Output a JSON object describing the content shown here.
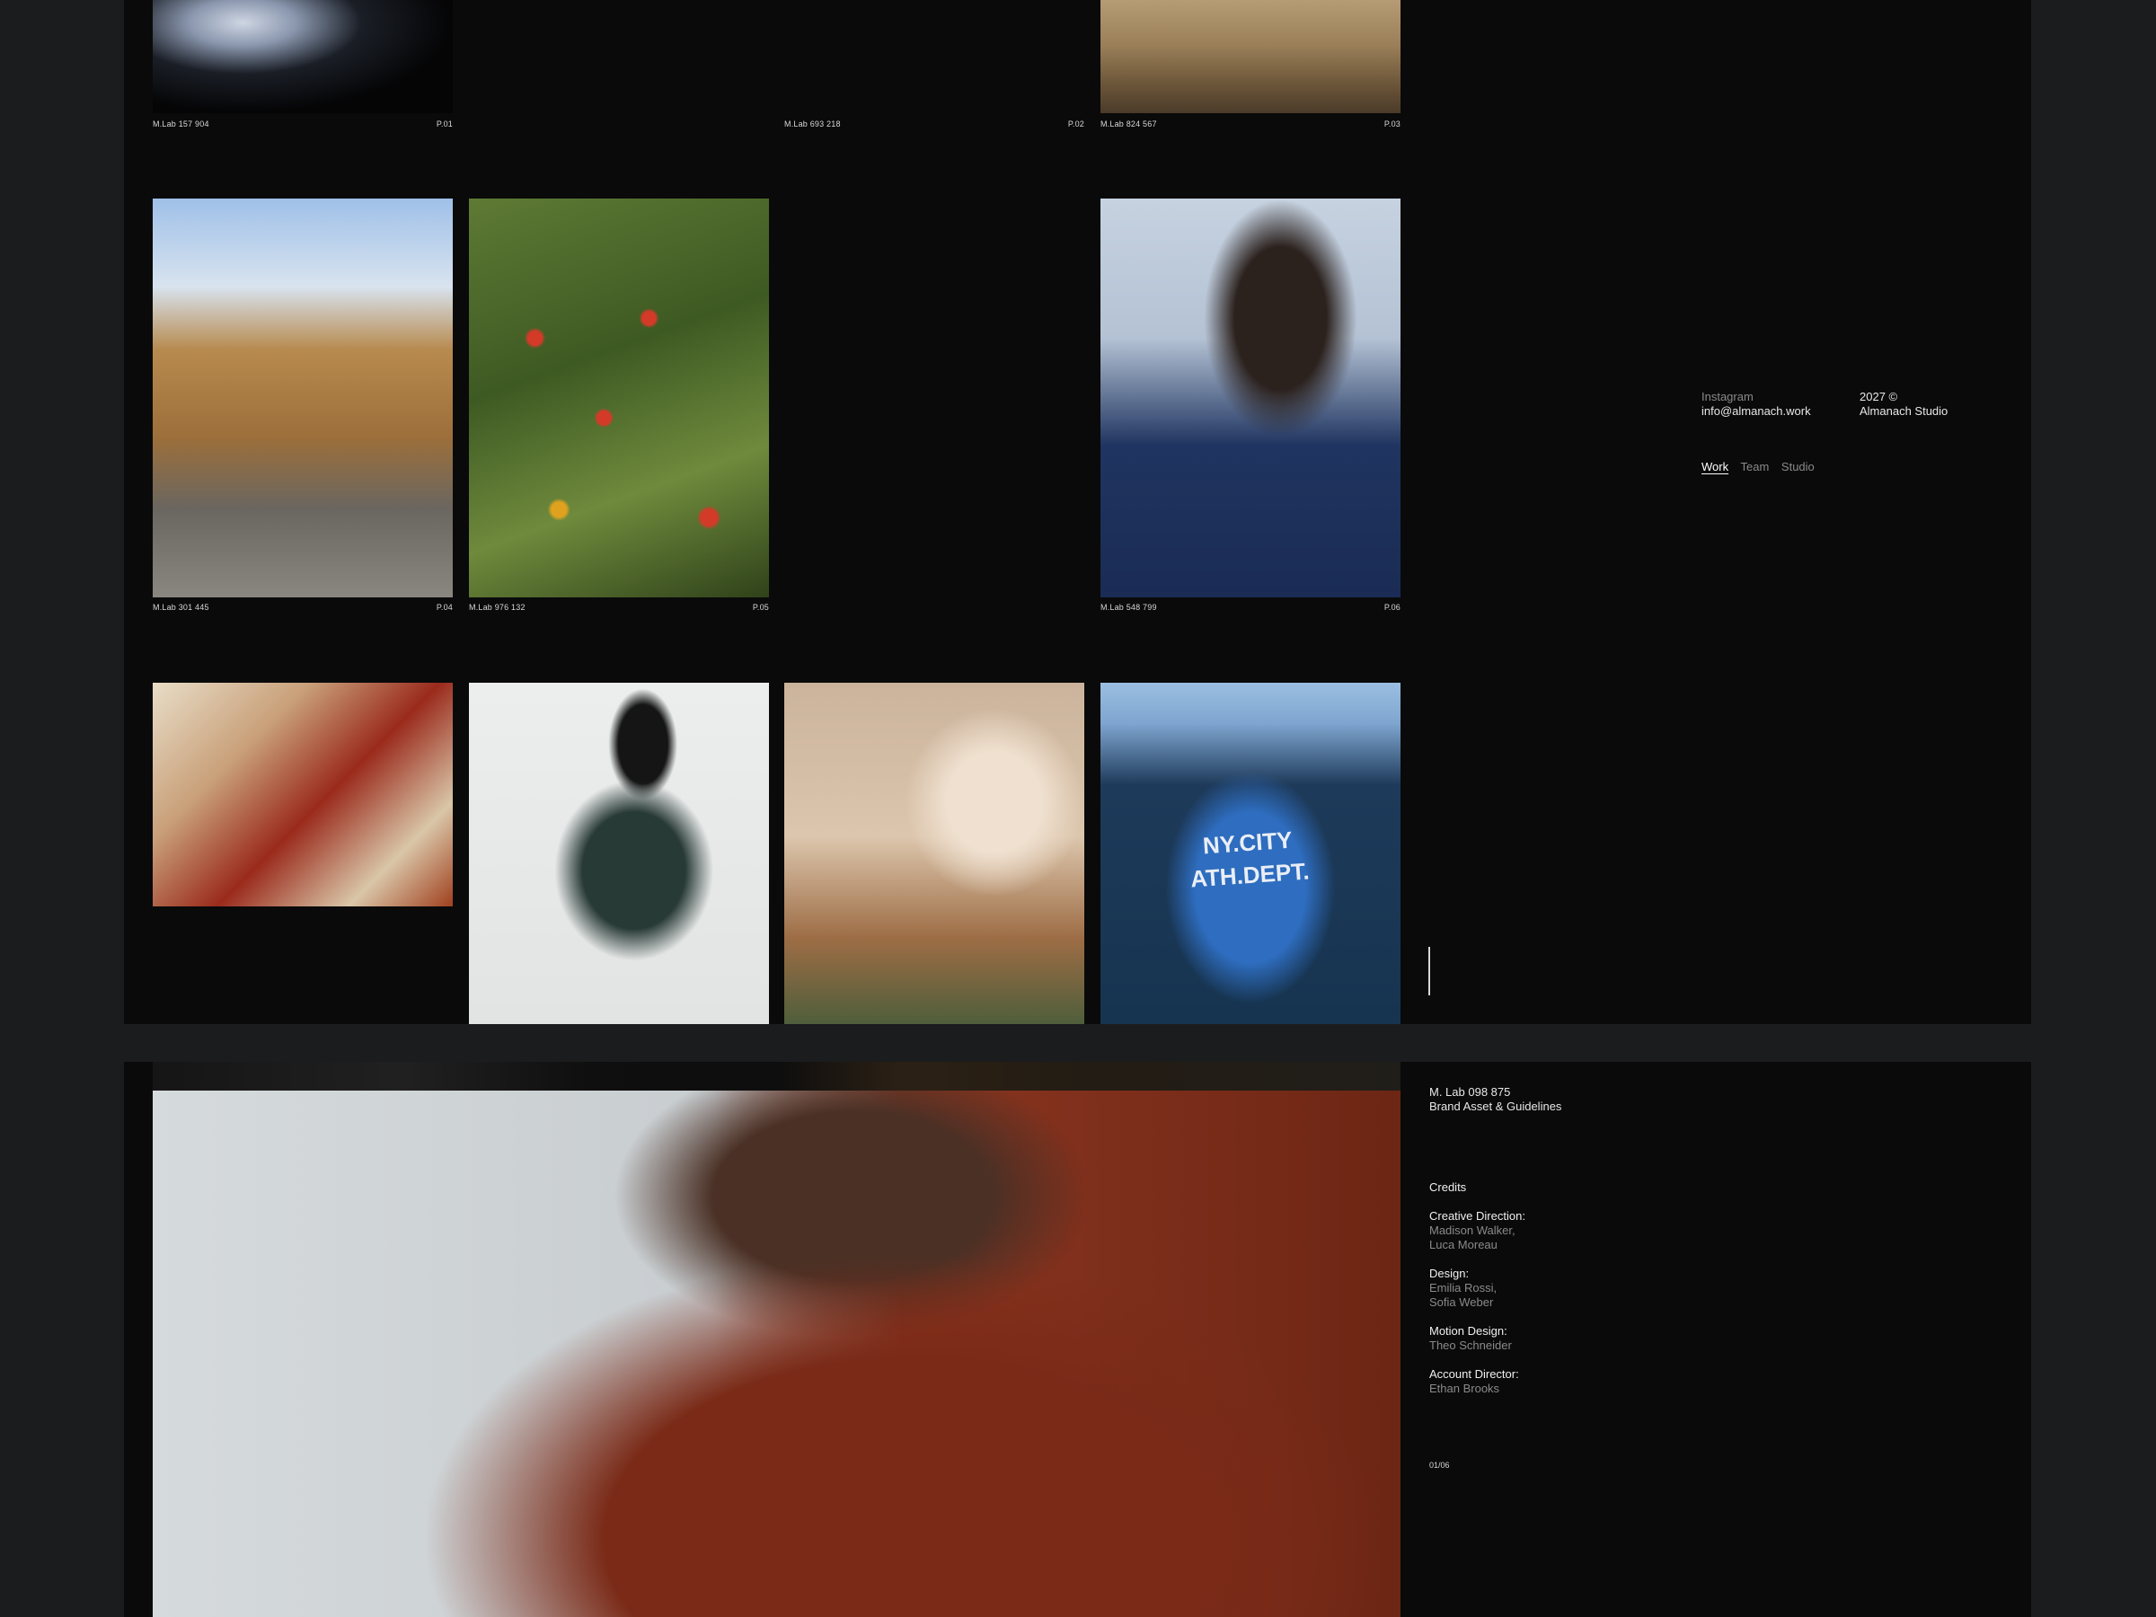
{
  "gallery": {
    "row1": [
      {
        "code": "M.Lab 157 904",
        "page": "P.01"
      },
      {
        "code": "M.Lab 693 218",
        "page": "P.02"
      },
      {
        "code": "M.Lab 824 567",
        "page": "P.03"
      }
    ],
    "row2": [
      {
        "code": "M.Lab 301 445",
        "page": "P.04"
      },
      {
        "code": "M.Lab 976 132",
        "page": "P.05"
      },
      {
        "code": "M.Lab 548 799",
        "page": "P.06"
      }
    ],
    "row3_jacket_text": {
      "line1": "NY.CITY",
      "line2": "ATH.DEPT."
    }
  },
  "contact": {
    "instagram": "Instagram",
    "email": "info@almanach.work",
    "year": "2027 ©",
    "studio": "Almanach Studio"
  },
  "nav": {
    "work": "Work",
    "team": "Team",
    "studio": "Studio"
  },
  "project": {
    "code": "M. Lab 098 875",
    "title": "Brand Asset & Guidelines",
    "credits_heading": "Credits",
    "credits": [
      {
        "role": "Creative Direction:",
        "names": [
          "Madison Walker,",
          "Luca Moreau"
        ]
      },
      {
        "role": "Design:",
        "names": [
          "Emilia Rossi,",
          "Sofia Weber"
        ]
      },
      {
        "role": "Motion Design:",
        "names": [
          "Theo Schneider"
        ]
      },
      {
        "role": "Account Director:",
        "names": [
          "Ethan Brooks"
        ]
      }
    ],
    "counter": "01/06"
  },
  "colors": {
    "background": "#1b1c1e",
    "panel": "#0a0a0a",
    "text": "#e8e8e8",
    "muted": "#8a8a8a"
  }
}
